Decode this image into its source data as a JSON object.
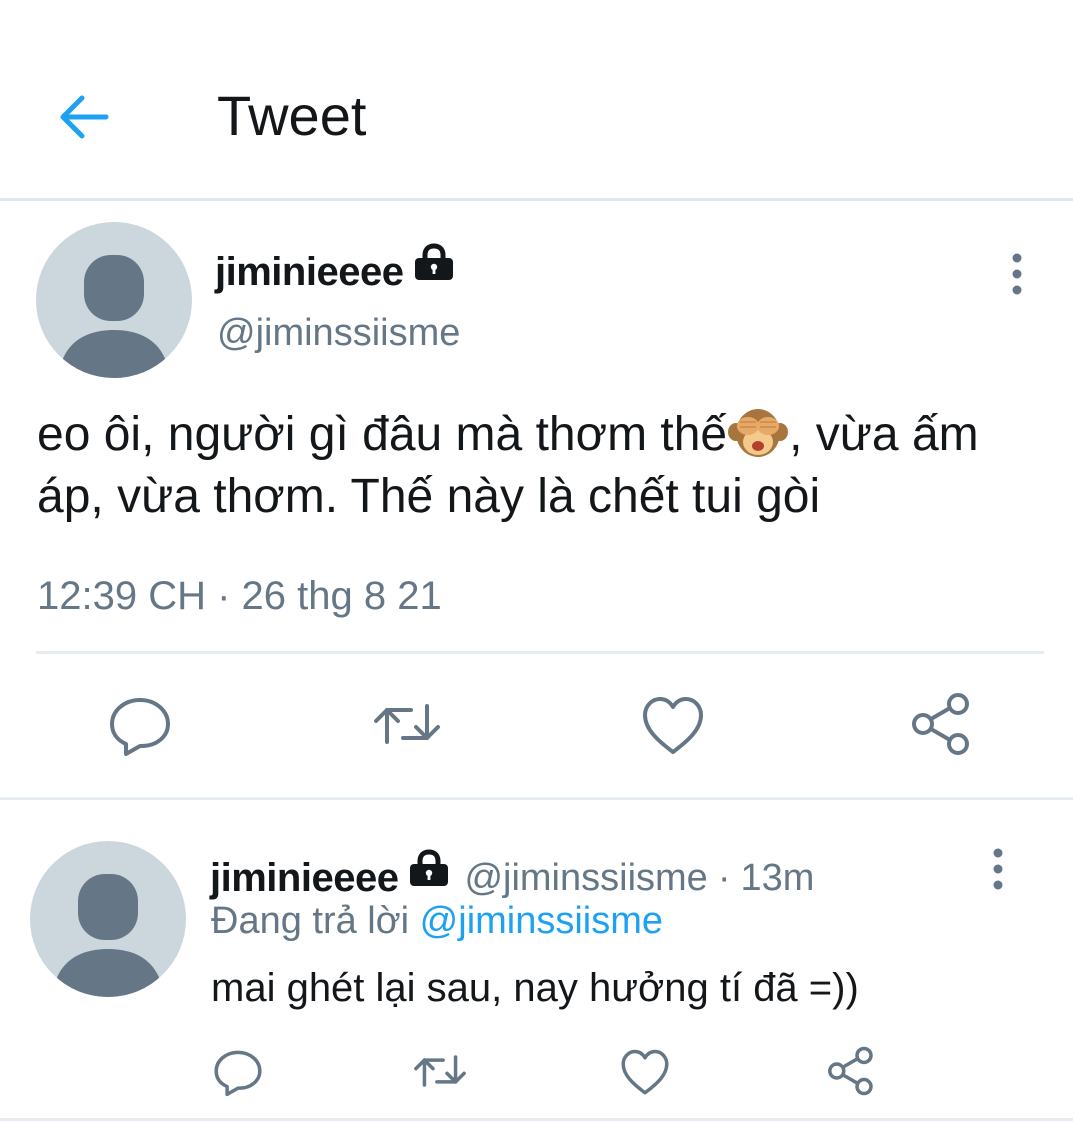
{
  "header": {
    "title": "Tweet",
    "back_icon": "arrow-left-icon",
    "accent_color": "#1da1f2"
  },
  "tweet": {
    "display_name": "jiminieeee",
    "handle": "@jiminssiisme",
    "protected": true,
    "text_part1": "eo ôi, người gì đâu mà thơm thế",
    "emoji": "see-no-evil-monkey-emoji",
    "text_part2": ", vừa ấm áp, vừa thơm. Thế này là chết tui gòi",
    "time": "12:39 CH · 26 thg 8 21",
    "actions": [
      "reply-icon",
      "retweet-icon",
      "like-icon",
      "share-icon"
    ]
  },
  "reply": {
    "display_name": "jiminieeee",
    "handle": "@jiminssiisme",
    "separator": "·",
    "time": "13m",
    "replying_prefix": "Đang trả lời",
    "replying_to": "@jiminssiisme",
    "text": "mai ghét lại sau, nay hưởng tí đã =))",
    "actions": [
      "reply-icon",
      "retweet-icon",
      "like-icon",
      "share-icon"
    ]
  },
  "colors": {
    "text": "#14171a",
    "secondary": "#657786",
    "link": "#1da1f2",
    "divider": "#e6ecf0",
    "avatar_bg": "#ccd6dd",
    "avatar_fg": "#657786"
  }
}
